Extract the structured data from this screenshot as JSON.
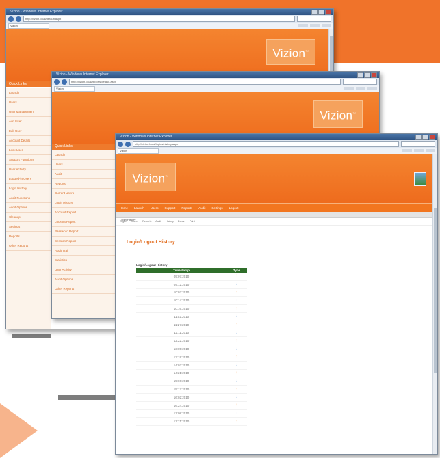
{
  "decor": {
    "accent": "#f0732a",
    "accent_light": "#f7b48c",
    "table_header": "#2f6e2a"
  },
  "windows": {
    "back": {
      "title": "Vizion - Windows Internet Explorer",
      "address": "http://vizion.local/default.aspx",
      "tab": "Vizion",
      "logo": "Vizion",
      "sidebar": {
        "header": "Quick Links",
        "items": [
          "Launch",
          "Users",
          "User Management",
          "Add User",
          "Edit User",
          "Account Details",
          "Lock User",
          "Support Functions",
          "User Activity",
          "Logged-in Users",
          "Login History",
          "Audit Functions",
          "Audit Options",
          "Cleanup",
          "Settings",
          "Reports",
          "Other Reports"
        ]
      }
    },
    "middle": {
      "title": "Vizion - Windows Internet Explorer",
      "address": "http://vizion.local/reports/default.aspx",
      "tab": "Vizion",
      "logo": "Vizion",
      "sidebar": {
        "header": "Quick Links",
        "items": [
          "Launch",
          "Users",
          "Audit",
          "Reports",
          "Current Users",
          "Login History",
          "Account Report",
          "Lockout Report",
          "Password Report",
          "Session Report",
          "Audit Trail",
          "Statistics",
          "User Activity",
          "Audit Options",
          "Other Reports"
        ]
      }
    },
    "front": {
      "title": "Vizion - Windows Internet Explorer",
      "address": "http://vizion.local/logins/history.aspx",
      "tab": "Vizion",
      "logo": "Vizion",
      "nav": [
        "Home",
        "Launch",
        "Users",
        "Support",
        "Reports",
        "Audit",
        "Settings",
        "Logout"
      ],
      "subheader": "Login History",
      "crumbs": [
        "Logins",
        "Users",
        "Reports",
        "Audit",
        "History",
        "Export",
        "Print"
      ],
      "page_title": "Login/Logout History",
      "table": {
        "caption": "Login/Logout History",
        "headers": [
          "Timestamp",
          "Type"
        ],
        "rows": [
          {
            "ts": "09:07:2010",
            "type": "in"
          },
          {
            "ts": "09:12:2010",
            "type": "out"
          },
          {
            "ts": "10:03:2010",
            "type": "in"
          },
          {
            "ts": "10:14:2010",
            "type": "out"
          },
          {
            "ts": "10:16:2010",
            "type": "in"
          },
          {
            "ts": "11:02:2010",
            "type": "out"
          },
          {
            "ts": "11:27:2010",
            "type": "in"
          },
          {
            "ts": "12:11:2010",
            "type": "out"
          },
          {
            "ts": "12:22:2010",
            "type": "in"
          },
          {
            "ts": "13:05:2010",
            "type": "out"
          },
          {
            "ts": "13:19:2010",
            "type": "in"
          },
          {
            "ts": "14:03:2010",
            "type": "out"
          },
          {
            "ts": "14:21:2010",
            "type": "in"
          },
          {
            "ts": "15:06:2010",
            "type": "out"
          },
          {
            "ts": "15:17:2010",
            "type": "in"
          },
          {
            "ts": "16:02:2010",
            "type": "out"
          },
          {
            "ts": "16:24:2010",
            "type": "in"
          },
          {
            "ts": "17:08:2010",
            "type": "out"
          },
          {
            "ts": "17:21:2010",
            "type": "in"
          }
        ]
      }
    }
  }
}
